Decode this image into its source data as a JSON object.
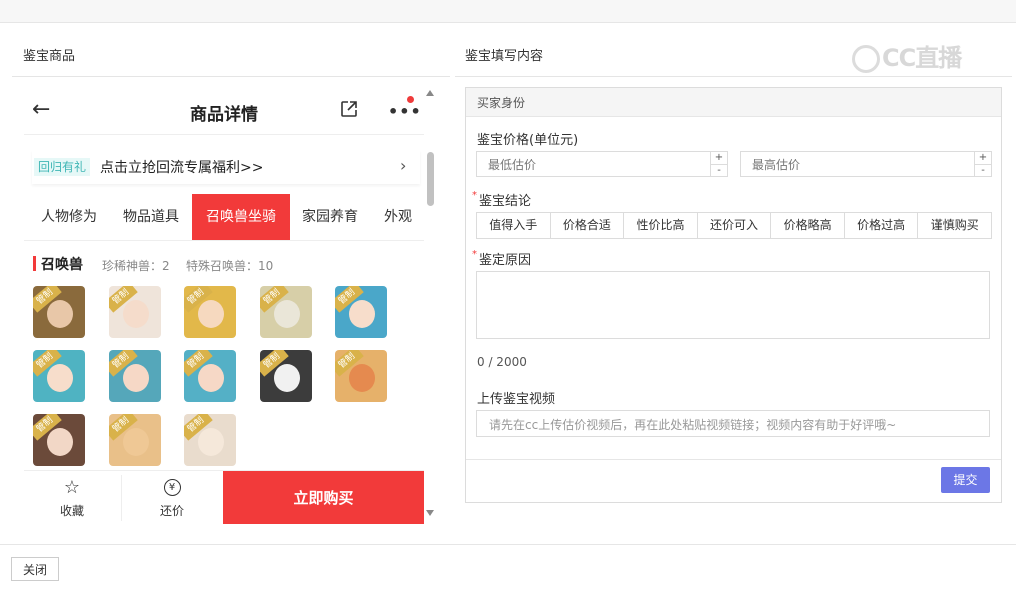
{
  "left_panel": {
    "title": "鉴宝商品"
  },
  "right_panel": {
    "title": "鉴宝填写内容"
  },
  "watermark": {
    "text": "CC直播"
  },
  "phone": {
    "header": {
      "back_icon": "arrow-left-icon",
      "title": "商品详情",
      "share_icon": "share-icon",
      "more_icon": "more-dots-icon",
      "more_glyph": "•••"
    },
    "promo": {
      "tag": "回归有礼",
      "text": "点击立抢回流专属福利>>",
      "arrow": "›"
    },
    "tabs": [
      {
        "label": "人物修为"
      },
      {
        "label": "物品道具"
      },
      {
        "label": "召唤兽坐骑"
      },
      {
        "label": "家园养育"
      },
      {
        "label": "外观"
      }
    ],
    "active_tab": "召唤兽坐骑",
    "section": {
      "title": "召唤兽",
      "stat1": "珍稀神兽：2",
      "stat2": "特殊召唤兽：10"
    },
    "avatar_badge": "管制",
    "avatars": [
      {
        "bg": "#8a6a3c",
        "face": "#e8c7a8"
      },
      {
        "bg": "#efe4da",
        "face": "#f5dccb"
      },
      {
        "bg": "#e2b84a",
        "face": "#f6d9bf"
      },
      {
        "bg": "#d7cfa8",
        "face": "#eae6d8"
      },
      {
        "bg": "#4aa7c9",
        "face": "#f7ddcb"
      },
      {
        "bg": "#4fb3c2",
        "face": "#f7ddcb"
      },
      {
        "bg": "#55a7ba",
        "face": "#f6d8c6"
      },
      {
        "bg": "#54b0c6",
        "face": "#f6d8c6"
      },
      {
        "bg": "#3c3c3c",
        "face": "#f1f1f1"
      },
      {
        "bg": "#e6b16a",
        "face": "#e58a4f"
      },
      {
        "bg": "#6b4a3a",
        "face": "#f2d7c6"
      },
      {
        "bg": "#e9c089",
        "face": "#efc895"
      },
      {
        "bg": "#e9dccd",
        "face": "#f5e8da"
      }
    ],
    "footer": {
      "favorite": {
        "icon": "star-icon",
        "glyph": "☆",
        "label": "收藏"
      },
      "bargain": {
        "icon": "yen-coin-icon",
        "glyph": "¥",
        "label": "还价"
      },
      "buy_label": "立即购买"
    }
  },
  "form": {
    "header": "买家身份",
    "price_label": "鉴宝价格(单位元)",
    "min_placeholder": "最低估价",
    "max_placeholder": "最高估价",
    "stepper_up": "+",
    "stepper_down": "-",
    "conclusion_label": "鉴宝结论",
    "conclusion_options": [
      {
        "label": "值得入手"
      },
      {
        "label": "价格合适"
      },
      {
        "label": "性价比高"
      },
      {
        "label": "还价可入"
      },
      {
        "label": "价格略高"
      },
      {
        "label": "价格过高"
      },
      {
        "label": "谨慎购买"
      }
    ],
    "reason_label": "鉴定原因",
    "counter": "0 / 2000",
    "video_label": "上传鉴宝视频",
    "video_placeholder": "请先在cc上传估价视频后，再在此处粘贴视频链接；视频内容有助于好评哦~",
    "submit_label": "提交",
    "required_mark": "*"
  },
  "close_label": "关闭"
}
